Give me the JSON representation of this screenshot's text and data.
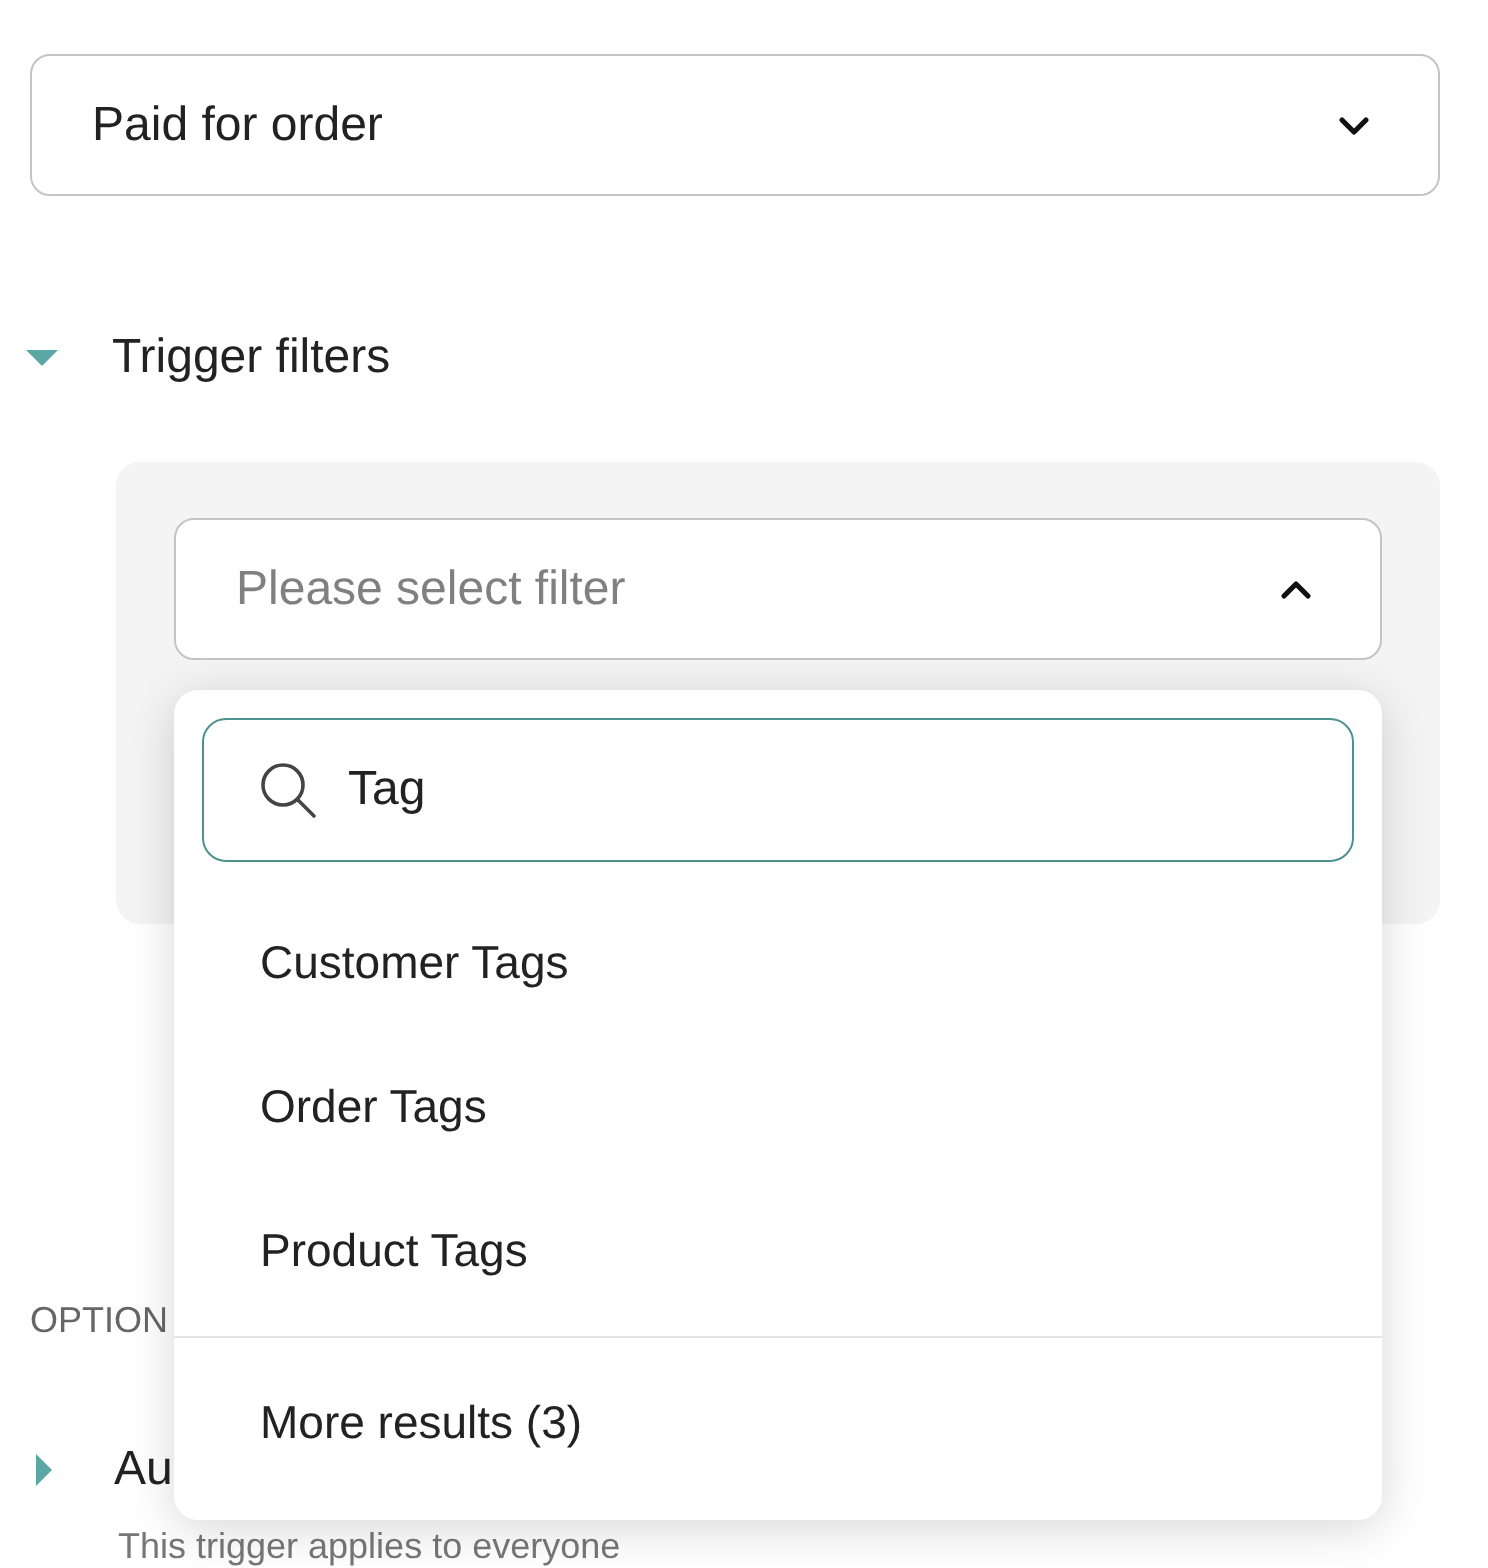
{
  "trigger_select": {
    "value": "Paid for order",
    "expanded": false
  },
  "trigger_filters": {
    "label": "Trigger filters",
    "expanded": true,
    "filter_select": {
      "placeholder": "Please select filter",
      "expanded": true
    },
    "dropdown": {
      "search": {
        "value": "Tag"
      },
      "options": [
        "Customer Tags",
        "Order Tags",
        "Product Tags"
      ],
      "more": "More results (3)"
    }
  },
  "options_heading": "OPTION",
  "section": {
    "label": "Au",
    "expanded": false,
    "description": "This trigger applies to everyone"
  }
}
